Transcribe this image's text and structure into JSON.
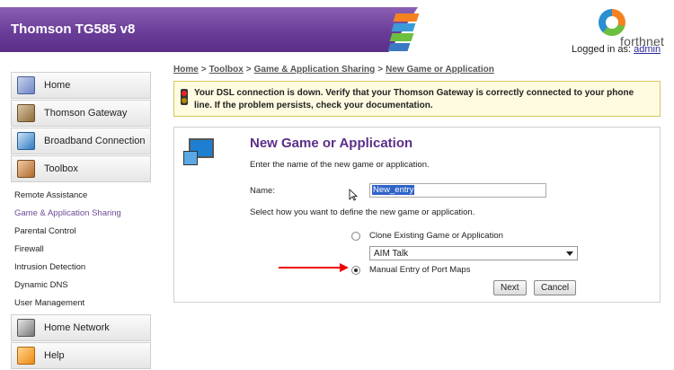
{
  "header": {
    "title": "Thomson TG585 v8",
    "logo_text": "forthnet",
    "logged_in_prefix": "Logged in as:",
    "user": "admin"
  },
  "sidebar": {
    "items": [
      {
        "label": "Home",
        "icon": "home-icon"
      },
      {
        "label": "Thomson Gateway",
        "icon": "gateway-icon"
      },
      {
        "label": "Broadband Connection",
        "icon": "broadband-icon"
      },
      {
        "label": "Toolbox",
        "icon": "toolbox-icon"
      }
    ],
    "toolbox_sub": [
      "Remote Assistance",
      "Game & Application Sharing",
      "Parental Control",
      "Firewall",
      "Intrusion Detection",
      "Dynamic DNS",
      "User Management"
    ],
    "bottom_items": [
      {
        "label": "Home Network",
        "icon": "home-network-icon"
      },
      {
        "label": "Help",
        "icon": "help-icon"
      }
    ]
  },
  "breadcrumb": [
    "Home",
    "Toolbox",
    "Game & Application Sharing",
    "New Game or Application"
  ],
  "alert": {
    "text": "Your DSL connection is down. Verify that your Thomson Gateway is correctly connected to your phone line. If the problem persists, check your documentation."
  },
  "panel": {
    "title": "New Game or Application",
    "instruction": "Enter the name of the new game or application.",
    "name_label": "Name:",
    "name_value": "New_entry",
    "define_instruction": "Select how you want to define the new game or application.",
    "option_clone": "Clone Existing Game or Application",
    "clone_select_value": "AIM Talk",
    "option_manual": "Manual Entry of Port Maps",
    "next_label": "Next",
    "cancel_label": "Cancel"
  },
  "colors": {
    "brand_purple": "#5b2f88",
    "alert_bg": "#fffbe0",
    "annotation_red": "#e00000"
  }
}
